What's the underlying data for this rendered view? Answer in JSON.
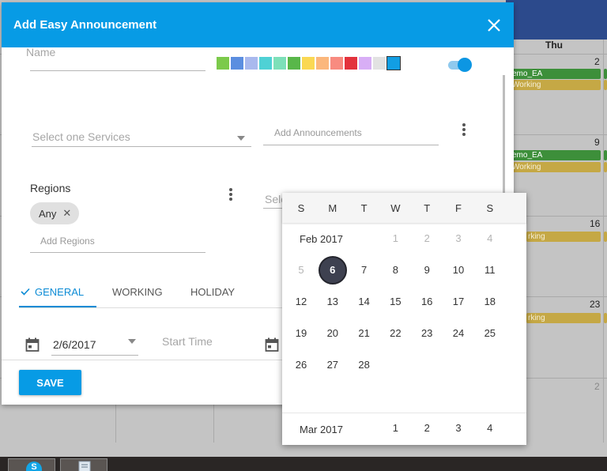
{
  "background_calendar": {
    "day_header": "Thu",
    "dates": [
      "2",
      "9",
      "16",
      "23",
      "2"
    ],
    "events": {
      "demo": "emo_EA",
      "working": "Working",
      "working_short": "rking"
    }
  },
  "dialog": {
    "title": "Add Easy Announcement",
    "name_placeholder": "Name",
    "services_placeholder": "Select one Services",
    "announcements_placeholder": "Add Announcements",
    "regions_label": "Regions",
    "region_chip": "Any",
    "regions_placeholder": "Add Regions",
    "select_placeholder": "Sele",
    "tabs": [
      "GENERAL",
      "WORKING",
      "HOLIDAY"
    ],
    "date_value": "2/6/2017",
    "start_time_placeholder": "Start Time",
    "save_label": "SAVE",
    "colors": [
      "#7cca4b",
      "#5b8ee0",
      "#a9b9ee",
      "#4fd1d5",
      "#7de0b9",
      "#59b74a",
      "#fad853",
      "#fbb77c",
      "#f88b80",
      "#e3333d",
      "#d8aef6",
      "#e2e2e2",
      "#129ee3"
    ],
    "selected_color_index": 12,
    "toggle_on": true
  },
  "date_picker": {
    "weekdays": [
      "S",
      "M",
      "T",
      "W",
      "T",
      "F",
      "S"
    ],
    "month_label": "Feb 2017",
    "prev_days": [
      "1",
      "2",
      "3",
      "4"
    ],
    "weeks": [
      [
        "5",
        "6",
        "7",
        "8",
        "9",
        "10",
        "11"
      ],
      [
        "12",
        "13",
        "14",
        "15",
        "16",
        "17",
        "18"
      ],
      [
        "19",
        "20",
        "21",
        "22",
        "23",
        "24",
        "25"
      ],
      [
        "26",
        "27",
        "28"
      ]
    ],
    "selected_day": "6",
    "next_month_label": "Mar 2017",
    "next_days": [
      "1",
      "2",
      "3",
      "4"
    ]
  }
}
